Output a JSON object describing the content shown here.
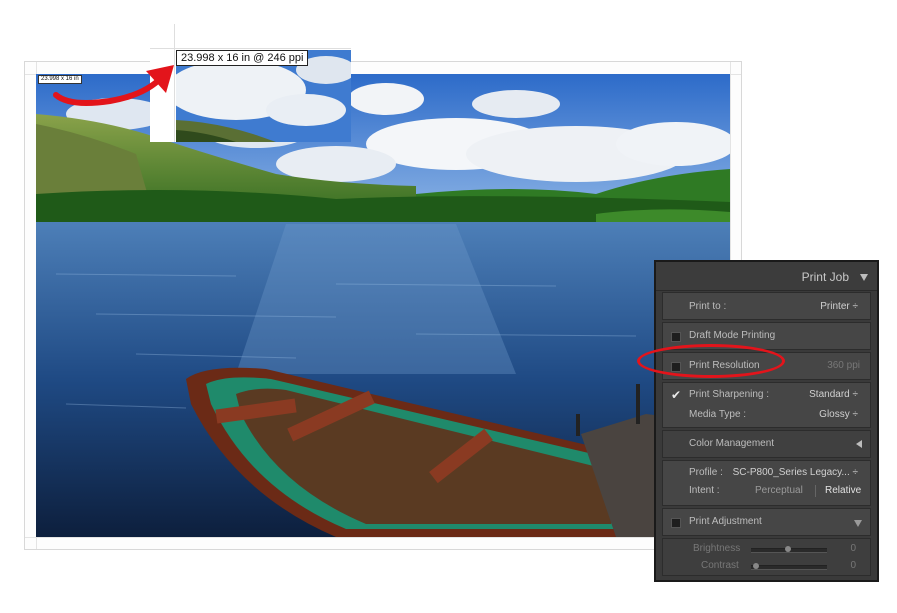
{
  "print_preview": {
    "size_label_small": "23.998 x 16 in",
    "size_label_zoom": "23.998 x 16 in @ 246 ppi"
  },
  "panel": {
    "title": "Print Job",
    "print_to": {
      "label": "Print to :",
      "value": "Printer ÷"
    },
    "draft_mode": {
      "label": "Draft Mode Printing",
      "checked": false
    },
    "print_resolution": {
      "label": "Print Resolution",
      "value": "360  ppi",
      "checked": false
    },
    "print_sharpening": {
      "label": "Print Sharpening :",
      "value": "Standard ÷",
      "checked": true
    },
    "media_type": {
      "label": "Media Type :",
      "value": "Glossy ÷"
    },
    "color_management": {
      "label": "Color Management"
    },
    "profile": {
      "label": "Profile :",
      "value": "SC-P800_Series Legacy... ÷"
    },
    "intent": {
      "label": "Intent :",
      "option1": "Perceptual",
      "option2": "Relative"
    },
    "print_adjustment": {
      "label": "Print Adjustment",
      "checked": false
    },
    "brightness": {
      "label": "Brightness",
      "value": "0"
    },
    "contrast": {
      "label": "Contrast",
      "value": "0"
    }
  },
  "colors": {
    "annotation": "#e3141b",
    "panel_bg": "#3a3a3a"
  }
}
